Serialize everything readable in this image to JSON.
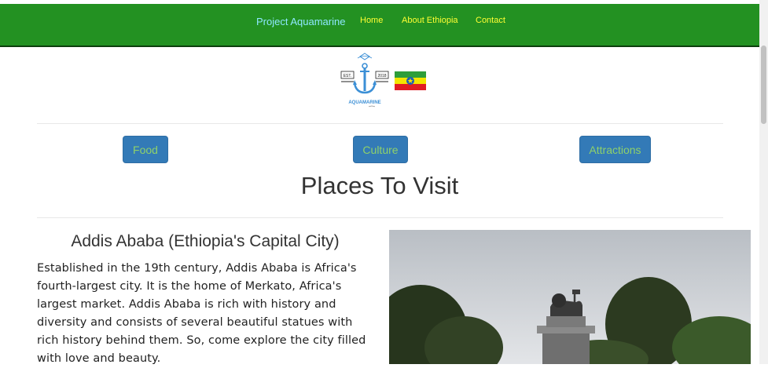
{
  "navbar": {
    "brand": "Project Aquamarine",
    "links": [
      "Home",
      "About Ethiopia",
      "Contact"
    ]
  },
  "logo": {
    "icon": "anchor-logo-icon",
    "text": "AQUAMARINE",
    "est_left": "EST.",
    "est_right": "2018"
  },
  "flag": {
    "icon": "ethiopia-flag-icon"
  },
  "buttons": [
    "Food",
    "Culture",
    "Attractions"
  ],
  "main": {
    "heading": "Places To Visit",
    "city_title": "Addis Ababa (Ethiopia's Capital City)",
    "description": "Established in the 19th century, Addis Ababa is Africa's fourth-largest city. It is the home of Merkato, Africa's largest market. Addis Ababa is rich with history and diversity and consists of several beautiful statues with rich history behind them. So, come explore the city filled with love and beauty."
  },
  "photo": {
    "icon": "lion-of-judah-statue-image"
  },
  "colors": {
    "navbar": "#239122",
    "brand": "#8fe8ff",
    "nav_links": "#ffff33",
    "button_bg": "#337ab7",
    "button_text": "#8fd16a"
  }
}
